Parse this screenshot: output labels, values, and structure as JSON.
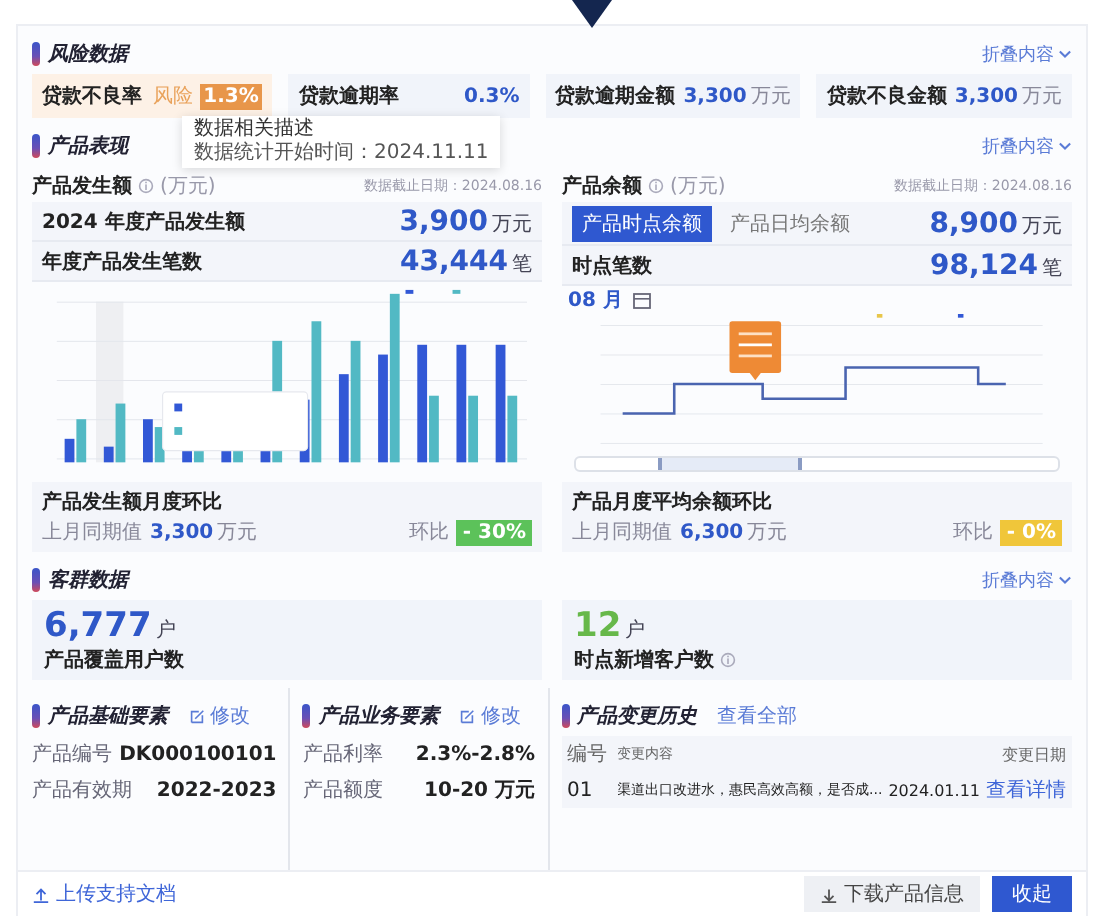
{
  "risk": {
    "title": "风险数据",
    "toggle": "折叠内容",
    "tiles": [
      {
        "kind": "alert",
        "label": "贷款不良率",
        "tag": "风险",
        "value": "1.3%"
      },
      {
        "kind": "normal",
        "label": "贷款逾期率",
        "value": "0.3%"
      },
      {
        "kind": "normal",
        "label": "贷款逾期金额",
        "value": "3,300",
        "unit": "万元"
      },
      {
        "kind": "normal",
        "label": "贷款不良金额",
        "value": "3,300",
        "unit": "万元"
      }
    ]
  },
  "performance": {
    "title": "产品表现",
    "toggle": "折叠内容",
    "amount_panel": {
      "title": "产品发生额",
      "unit": "(万元)",
      "date": "数据截止日期：2024.08.16",
      "tooltip": {
        "title": "数据相关描述",
        "text": "数据统计开始时间：2024.11.11"
      },
      "rows": [
        {
          "label": "2024 年度产品发生额",
          "value": "3,900",
          "unit": "万元"
        },
        {
          "label": "年度产品发生笔数",
          "value": "43,444",
          "unit": "笔"
        }
      ],
      "compare": {
        "title": "产品发生额月度环比",
        "label": "上月同期值",
        "value": "3,300",
        "unit": "万元",
        "change_label": "环比",
        "change": "- 30%",
        "color": "#5cc25a"
      }
    },
    "balance_panel": {
      "title": "产品余额",
      "unit": "(万元)",
      "date": "数据截止日期：2024.08.16",
      "tabs": [
        {
          "label": "产品时点余额",
          "selected": true
        },
        {
          "label": "产品日均余额",
          "selected": false
        }
      ],
      "rows": [
        {
          "label": "时点笔数",
          "value": "98,124",
          "unit": "笔"
        }
      ],
      "tab_value": "8,900",
      "tab_unit": "万元",
      "month": "08 月",
      "compare": {
        "title": "产品月度平均余额环比",
        "label": "上月同期值",
        "value": "6,300",
        "unit": "万元",
        "change_label": "环比",
        "change": "- 0%",
        "color": "#f0c63a"
      }
    }
  },
  "customers": {
    "title": "客群数据",
    "toggle": "折叠内容",
    "tiles": [
      {
        "value": "6,777",
        "unit": "户",
        "label": "产品覆盖用户数",
        "color": "#2f58c8",
        "info": false
      },
      {
        "value": "12",
        "unit": "户",
        "label": "时点新增客户数",
        "color": "#67b84a",
        "info": true
      }
    ]
  },
  "basic": {
    "title": "产品基础要素",
    "action": "修改",
    "fields": [
      {
        "label": "产品编号",
        "value": "DK000100101"
      },
      {
        "label": "产品有效期",
        "value": "2022-2023"
      }
    ]
  },
  "business": {
    "title": "产品业务要素",
    "action": "修改",
    "fields": [
      {
        "label": "产品利率",
        "value": "2.3%-2.8%"
      },
      {
        "label": "产品额度",
        "value": "10-20 万元"
      }
    ]
  },
  "history": {
    "title": "产品变更历史",
    "action": "查看全部",
    "columns": [
      "编号",
      "变更内容",
      "变更日期"
    ],
    "rows": [
      {
        "no": "01",
        "content": "渠道出口改进水，惠民高效高额，是否成...",
        "date": "2024.01.11",
        "link": "查看详情"
      }
    ]
  },
  "footer": {
    "upload": "上传支持文档",
    "download": "下载产品信息",
    "collapse": "收起"
  }
}
